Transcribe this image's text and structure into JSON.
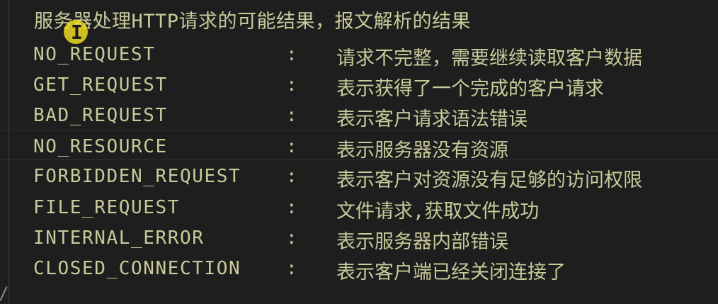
{
  "heading": "服务器处理HTTP请求的可能结果，报文解析的结果",
  "separator": ":",
  "entries": [
    {
      "code": "NO_REQUEST",
      "desc": "请求不完整，需要继续读取客户数据"
    },
    {
      "code": "GET_REQUEST",
      "desc": "表示获得了一个完成的客户请求"
    },
    {
      "code": "BAD_REQUEST",
      "desc": "表示客户请求语法错误"
    },
    {
      "code": "NO_RESOURCE",
      "desc": "表示服务器没有资源"
    },
    {
      "code": "FORBIDDEN_REQUEST",
      "desc": "表示客户对资源没有足够的访问权限"
    },
    {
      "code": "FILE_REQUEST",
      "desc": "文件请求,获取文件成功"
    },
    {
      "code": "INTERNAL_ERROR",
      "desc": "表示服务器内部错误"
    },
    {
      "code": "CLOSED_CONNECTION",
      "desc": "表示客户端已经关闭连接了"
    }
  ],
  "trailing_text": "/",
  "cursor_glyph": "I",
  "colors": {
    "background": "#1e1e1e",
    "text": "#c8ca9a",
    "cursor_highlight": "#eedc1e"
  },
  "icons": {
    "cursor": "text-cursor-icon"
  }
}
